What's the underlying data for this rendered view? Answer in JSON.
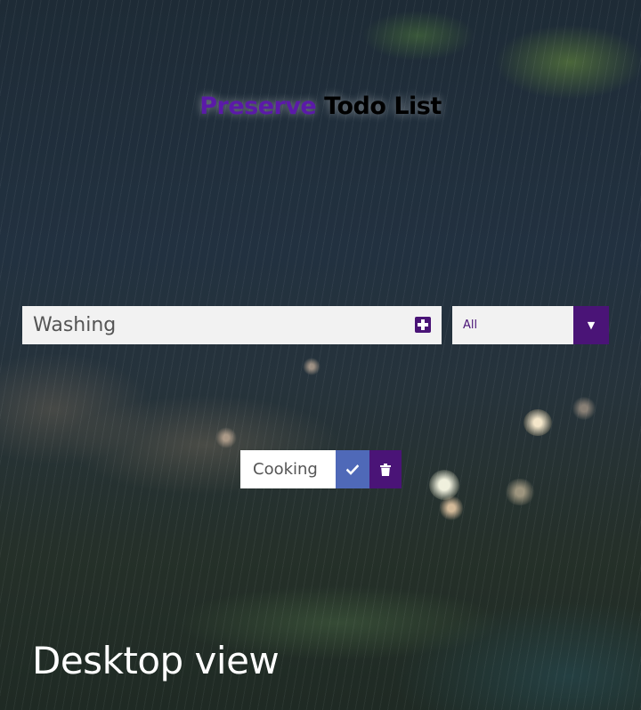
{
  "header": {
    "title_accent": "Preserve",
    "title_rest": "Todo List"
  },
  "form": {
    "input_value": "Washing",
    "add_icon": "plus-square-icon",
    "filter_selected": "All",
    "filter_icon": "caret-down-icon"
  },
  "todos": [
    {
      "text": "Cooking",
      "complete_icon": "check-icon",
      "delete_icon": "trash-icon"
    }
  ],
  "caption": "Desktop view",
  "colors": {
    "accent_purple": "#4a1477",
    "title_purple": "#5b1aa8",
    "complete_blue": "#4f69b8",
    "field_bg": "#f2f2f2"
  }
}
